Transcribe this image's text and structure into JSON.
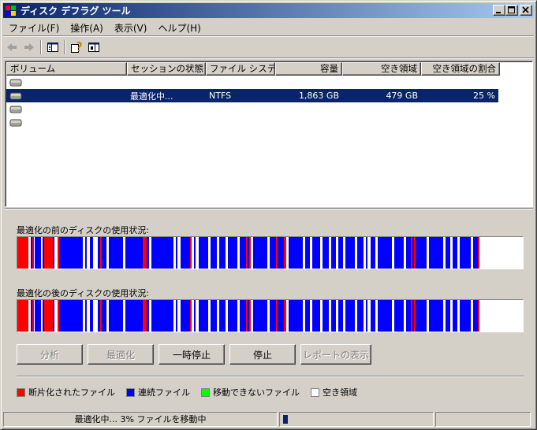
{
  "window": {
    "title": "ディスク デフラグ ツール",
    "menus": [
      "ファイル(F)",
      "操作(A)",
      "表示(V)",
      "ヘルプ(H)"
    ]
  },
  "volumes": {
    "columns": [
      "ボリューム",
      "セッションの状態",
      "ファイル システム",
      "容量",
      "空き領域",
      "空き領域の割合"
    ],
    "rows": [
      {
        "volume": "",
        "status": "",
        "fs": "",
        "capacity": "",
        "free": "",
        "free_pct": "",
        "selected": false
      },
      {
        "volume": "",
        "status": "最適化中...",
        "fs": "NTFS",
        "capacity": "1,863 GB",
        "free": "479 GB",
        "free_pct": "25 %",
        "selected": true
      },
      {
        "volume": "",
        "status": "",
        "fs": "",
        "capacity": "",
        "free": "",
        "free_pct": "",
        "selected": false
      },
      {
        "volume": "",
        "status": "",
        "fs": "",
        "capacity": "",
        "free": "",
        "free_pct": "",
        "selected": false
      }
    ]
  },
  "analysis": {
    "before_label": "最適化の前のディスクの使用状況:",
    "after_label": "最適化の後のディスクの使用状況:"
  },
  "buttons": {
    "analyze": "分析",
    "defrag": "最適化",
    "pause": "一時停止",
    "stop": "停止",
    "report": "レポートの表示"
  },
  "legend": {
    "fragmented": "断片化されたファイル",
    "contiguous": "連続ファイル",
    "unmovable": "移動できないファイル",
    "free": "空き領域"
  },
  "colors": {
    "fragmented": "#ff0000",
    "contiguous": "#0000ff",
    "unmovable": "#00ff00",
    "free": "#ffffff",
    "selection": "#0a246a",
    "title_start": "#0a246a",
    "title_end": "#a6caf0"
  },
  "status": {
    "text": "最適化中... 3%  ファイルを移動中",
    "progress": 0.03
  },
  "icons": {
    "app": "defrag-app-icon",
    "back": "back-arrow-icon",
    "forward": "forward-arrow-icon",
    "console": "show-hide-console-tree-icon",
    "help": "help-icon",
    "action_pane": "action-pane-icon",
    "drive": "hard-drive-icon"
  }
}
